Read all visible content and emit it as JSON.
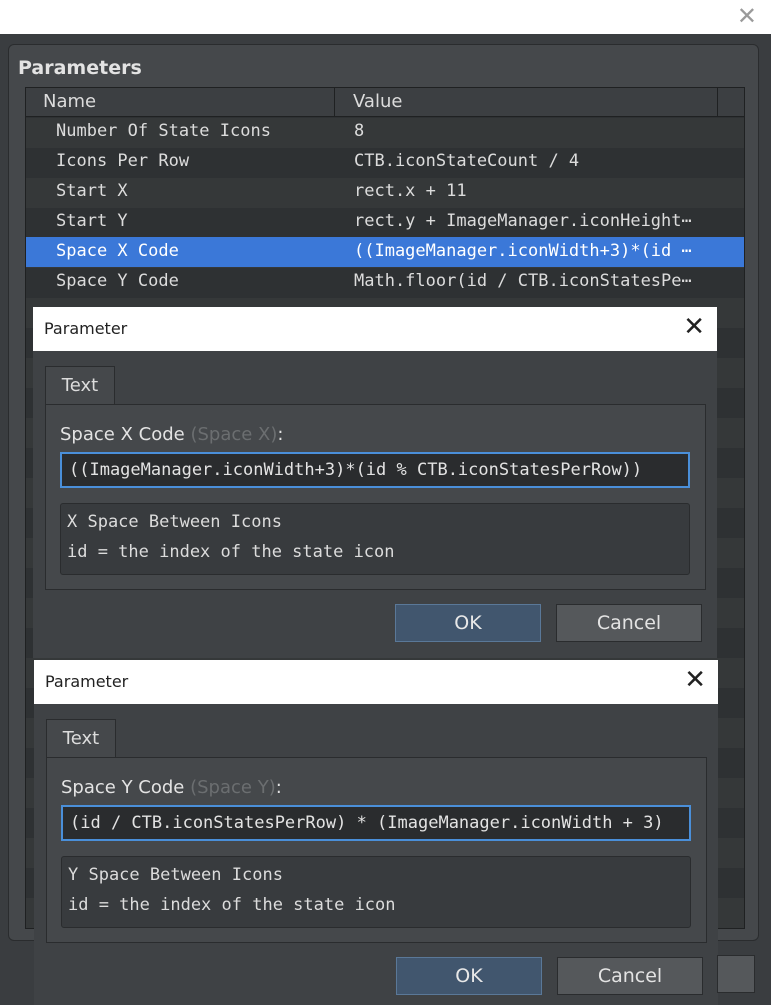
{
  "window": {
    "close_glyph": "✕"
  },
  "parameters": {
    "title": "Parameters",
    "columns": {
      "name": "Name",
      "value": "Value"
    },
    "rows": [
      {
        "name": "Number Of State Icons",
        "value": "8"
      },
      {
        "name": "Icons Per Row",
        "value": "CTB.iconStateCount / 4"
      },
      {
        "name": "Start X",
        "value": "rect.x + 11"
      },
      {
        "name": "Start Y",
        "value": "rect.y + ImageManager.iconHeight⋯"
      },
      {
        "name": "Space X Code",
        "value": "((ImageManager.iconWidth+3)*(id ⋯",
        "selected": true
      },
      {
        "name": "Space Y Code",
        "value": "Math.floor(id / CTB.iconStatesPe⋯"
      }
    ]
  },
  "dialog1": {
    "title": "Parameter",
    "close_glyph": "✕",
    "tab": "Text",
    "field_label": "Space X Code",
    "field_hint": "(Space X)",
    "field_colon": ":",
    "value": "((ImageManager.iconWidth+3)*(id % CTB.iconStatesPerRow))",
    "description": [
      "X Space Between Icons",
      "id = the index of the state icon"
    ],
    "ok": "OK",
    "cancel": "Cancel"
  },
  "dialog2": {
    "title": "Parameter",
    "close_glyph": "✕",
    "tab": "Text",
    "field_label": "Space Y Code",
    "field_hint": "(Space Y)",
    "field_colon": ":",
    "value": "(id / CTB.iconStatesPerRow) * (ImageManager.iconWidth + 3)",
    "description": [
      "Y Space Between Icons",
      "id = the index of the state icon"
    ],
    "ok": "OK",
    "cancel": "Cancel"
  },
  "colors": {
    "selection": "#3b78d8",
    "focus_border": "#4a8fd9",
    "background": "#3a3d40"
  }
}
